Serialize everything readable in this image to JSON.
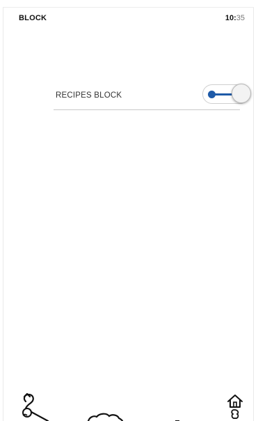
{
  "header": {
    "title": "BLOCK",
    "time_hour": "10:",
    "time_minute": "35"
  },
  "settings": {
    "recipes_block": {
      "label": "RECIPES BLOCK",
      "state": "on"
    }
  },
  "colors": {
    "accent": "#1e5aa8"
  },
  "bottom_nav": {
    "icons": [
      "back-arrow-icon",
      "chef-hat-icon",
      "home-icon"
    ]
  }
}
